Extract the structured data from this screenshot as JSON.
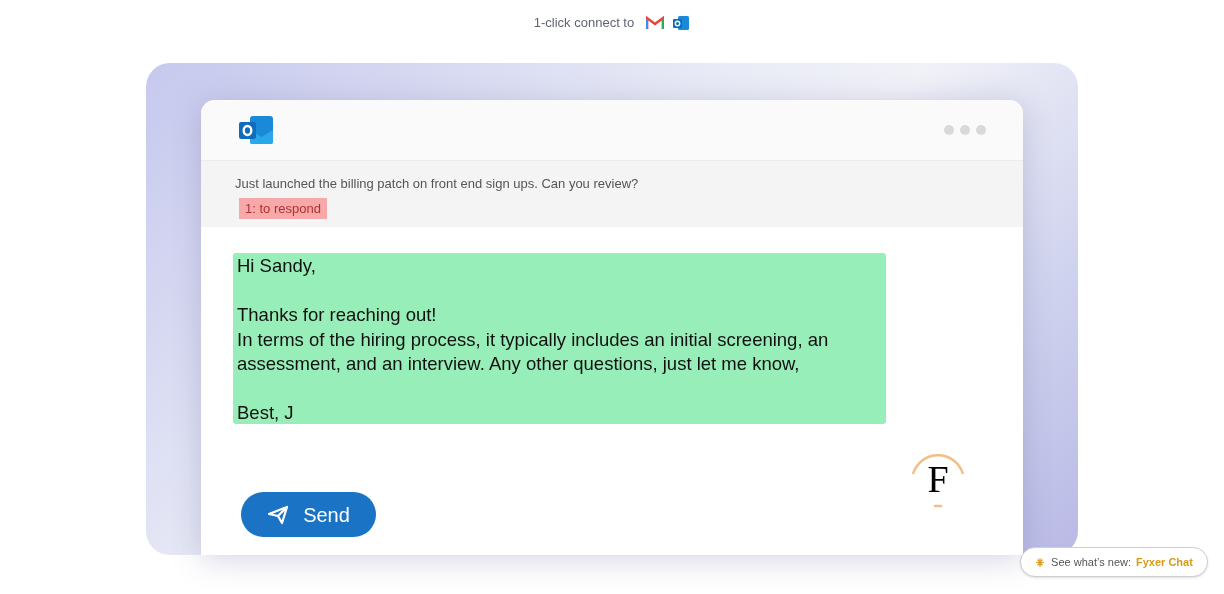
{
  "header": {
    "text": "1-click connect to"
  },
  "email": {
    "subject": "Just launched the billing patch on front end sign ups. Can you review?",
    "tag": "1: to respond",
    "reply_paragraphs": [
      [
        "Hi Sandy,"
      ],
      [
        "Thanks for reaching out!",
        "In terms of the hiring process, it typically includes an initial screening, an assessment, and an interview. Any other questions, just let me know,"
      ],
      [
        "Best, J"
      ]
    ],
    "send_button": "Send",
    "logo_letter": "F"
  },
  "toast": {
    "label": "See what’s new:",
    "link": "Fyxer Chat"
  }
}
